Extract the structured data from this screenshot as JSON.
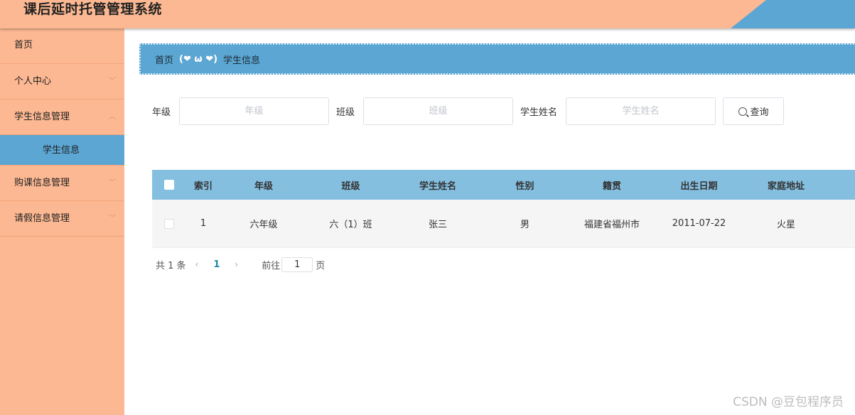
{
  "header": {
    "title": "课后延时托管管理系统"
  },
  "sidebar": {
    "items": [
      {
        "label": "首页"
      },
      {
        "label": "个人中心"
      },
      {
        "label": "学生信息管理",
        "sub": [
          {
            "label": "学生信息"
          }
        ]
      },
      {
        "label": "购课信息管理"
      },
      {
        "label": "请假信息管理"
      }
    ]
  },
  "breadcrumb": {
    "home": "首页",
    "separator": "(❤ ω ❤)",
    "current": "学生信息"
  },
  "search": {
    "grade_label": "年级",
    "grade_placeholder": "年级",
    "class_label": "班级",
    "class_placeholder": "班级",
    "name_label": "学生姓名",
    "name_placeholder": "学生姓名",
    "query_label": "查询"
  },
  "table": {
    "headers": {
      "index": "索引",
      "grade": "年级",
      "class": "班级",
      "name": "学生姓名",
      "sex": "性别",
      "origin": "籍贯",
      "birth": "出生日期",
      "address": "家庭地址"
    },
    "rows": [
      {
        "index": "1",
        "grade": "六年级",
        "class": "六（1）班",
        "name": "张三",
        "sex": "男",
        "origin": "福建省福州市",
        "birth": "2011-07-22",
        "address": "火星"
      }
    ]
  },
  "pager": {
    "total": "共 1 条",
    "prev": "‹",
    "page": "1",
    "next": "›",
    "goto": "前往",
    "goto_value": "1",
    "unit": "页"
  },
  "watermark": "CSDN @豆包程序员",
  "colors": {
    "header": "#fcb892",
    "accent": "#5ba6d3",
    "table_head": "#85bfe0"
  }
}
